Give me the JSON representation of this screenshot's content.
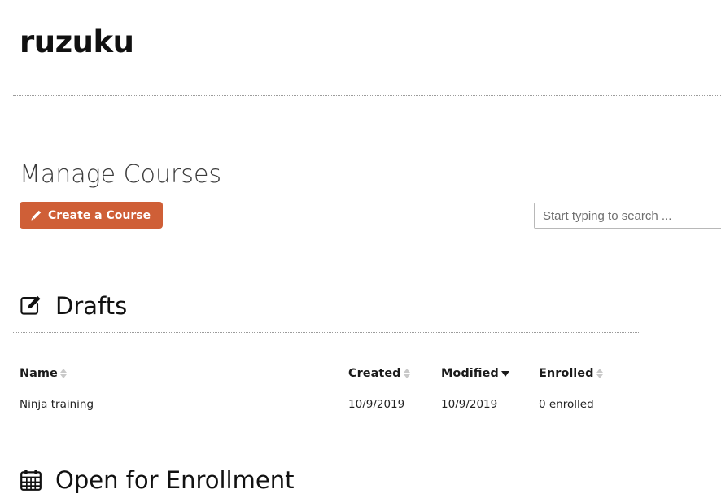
{
  "brand": {
    "logo_text": "ruzuku"
  },
  "page": {
    "title": "Manage Courses"
  },
  "toolbar": {
    "create_label": "Create a Course",
    "create_icon": "pencil-icon",
    "create_color": "#cf5f37",
    "search_placeholder": "Start typing to search ...",
    "search_value": ""
  },
  "sections": [
    {
      "id": "drafts",
      "icon": "pencil-square-icon",
      "title": "Drafts",
      "columns": [
        {
          "key": "name",
          "label": "Name",
          "sort": "none"
        },
        {
          "key": "created",
          "label": "Created",
          "sort": "none"
        },
        {
          "key": "modified",
          "label": "Modified",
          "sort": "desc"
        },
        {
          "key": "enrolled",
          "label": "Enrolled",
          "sort": "none"
        }
      ],
      "rows": [
        {
          "name": "Ninja training",
          "created": "10/9/2019",
          "modified": "10/9/2019",
          "enrolled": "0 enrolled"
        }
      ]
    },
    {
      "id": "open-for-enrollment",
      "icon": "calendar-icon",
      "title": "Open for Enrollment",
      "columns": [],
      "rows": []
    }
  ]
}
